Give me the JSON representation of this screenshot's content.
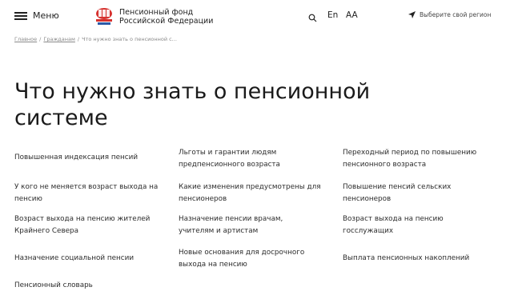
{
  "header": {
    "menu_label": "Меню",
    "logo_line1": "Пенсионный фонд",
    "logo_line2": "Российской Федерации",
    "lang_label": "En",
    "accessibility_label": "AA",
    "region_label": "Выберите свой регион"
  },
  "breadcrumb": {
    "items": [
      "Главное",
      "Гражданам",
      "Что нужно знать о пенсионной с..."
    ]
  },
  "page": {
    "title": "Что нужно знать о пенсионной системе"
  },
  "links": [
    "Повышенная индексация пенсий",
    "Льготы и гарантии людям предпенсионного возраста",
    "Переходный период по повышению пенсионного возраста",
    "У кого не меняется возраст выхода на пенсию",
    "Какие изменения предусмотрены для пенсионеров",
    "Повышение пенсий сельских пенсионеров",
    "Возраст выхода на пенсию жителей Крайнего Севера",
    "Назначение пенсии врачам, учителям и артистам",
    "Возраст выхода на пенсию госслужащих",
    "Назначение социальной пенсии",
    "Новые основания для досрочного выхода на пенсию",
    "Выплата пенсионных накоплений",
    "Пенсионный словарь"
  ],
  "colors": {
    "logo_red": "#d6312e",
    "text": "#212121"
  },
  "icons": {
    "menu": "burger-icon",
    "search": "search-icon",
    "region": "location-arrow-icon"
  }
}
